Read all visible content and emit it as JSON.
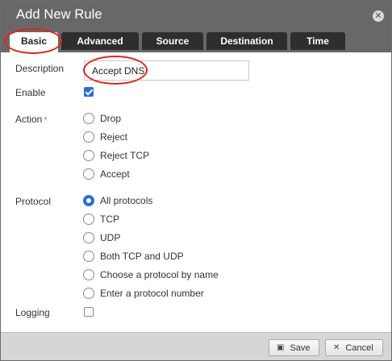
{
  "dialog": {
    "title": "Add New Rule",
    "close_icon": "close-icon"
  },
  "tabs": [
    {
      "label": "Basic",
      "active": true
    },
    {
      "label": "Advanced"
    },
    {
      "label": "Source"
    },
    {
      "label": "Destination"
    },
    {
      "label": "Time"
    }
  ],
  "form": {
    "description": {
      "label": "Description",
      "value": "Accept DNS"
    },
    "enable": {
      "label": "Enable",
      "checked": true
    },
    "action": {
      "label": "Action",
      "required_mark": "*",
      "options": [
        "Drop",
        "Reject",
        "Reject TCP",
        "Accept"
      ],
      "selected": null
    },
    "protocol": {
      "label": "Protocol",
      "options": [
        "All protocols",
        "TCP",
        "UDP",
        "Both TCP and UDP",
        "Choose a protocol by name",
        "Enter a protocol number"
      ],
      "selected": "All protocols"
    },
    "logging": {
      "label": "Logging",
      "checked": false
    }
  },
  "footer": {
    "save_label": "Save",
    "save_icon": "floppy-icon",
    "cancel_label": "Cancel",
    "cancel_icon": "close-icon"
  },
  "colors": {
    "titlebar": "#686868",
    "tab_inactive": "#2e2e2e",
    "accent": "#2b6cd8",
    "annotation": "#e0231c"
  }
}
